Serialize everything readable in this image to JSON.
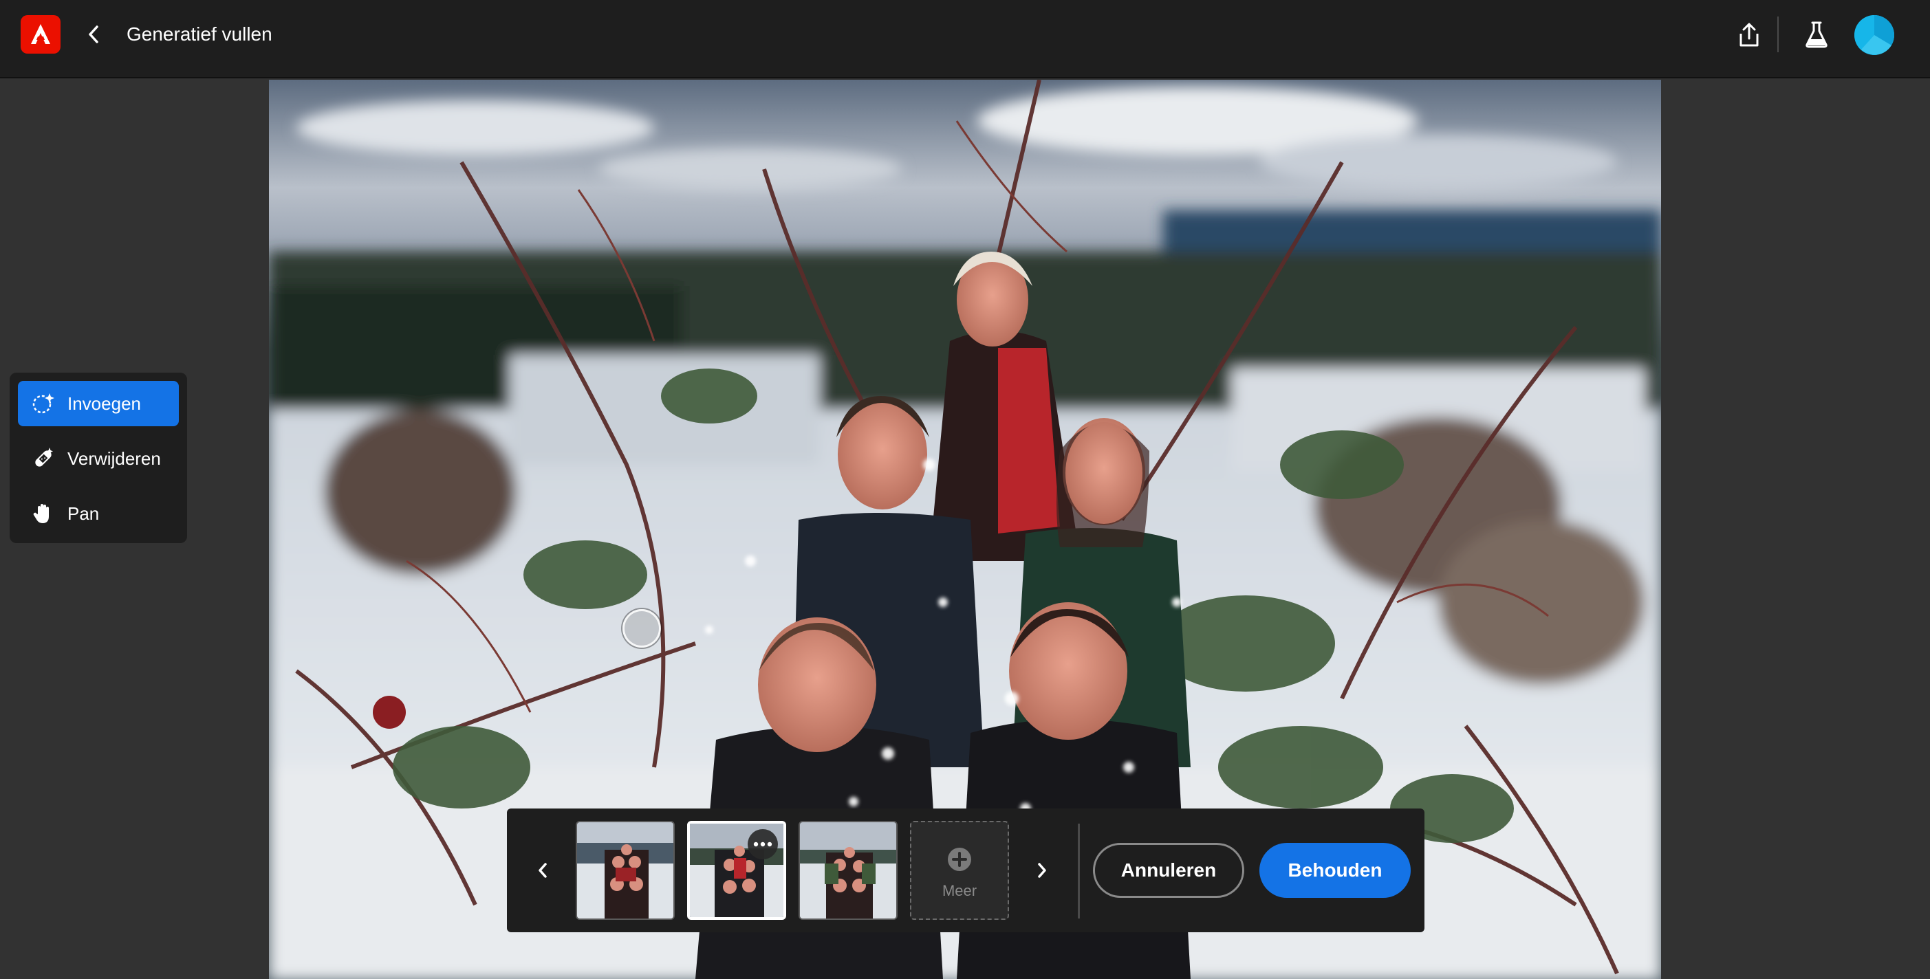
{
  "header": {
    "title": "Generatief vullen",
    "logo_icon": "adobe-acrobat-icon",
    "back_icon": "chevron-left-icon",
    "share_icon": "share-icon",
    "labs_icon": "flask-icon",
    "avatar_color": "#16b6e9"
  },
  "tools": {
    "items": [
      {
        "label": "Invoegen",
        "icon": "generative-fill-icon",
        "active": true
      },
      {
        "label": "Verwijderen",
        "icon": "eraser-bandage-icon",
        "active": false
      },
      {
        "label": "Pan",
        "icon": "hand-icon",
        "active": false
      }
    ]
  },
  "variations": {
    "prev_icon": "chevron-left-icon",
    "next_icon": "chevron-right-icon",
    "thumbnails": [
      {
        "selected": false
      },
      {
        "selected": true
      },
      {
        "selected": false
      }
    ],
    "more_label": "Meer",
    "cancel_label": "Annuleren",
    "keep_label": "Behouden"
  },
  "colors": {
    "accent": "#1473e6",
    "logo": "#eb1000",
    "topbar": "#1e1e1e",
    "workspace": "#323232"
  }
}
